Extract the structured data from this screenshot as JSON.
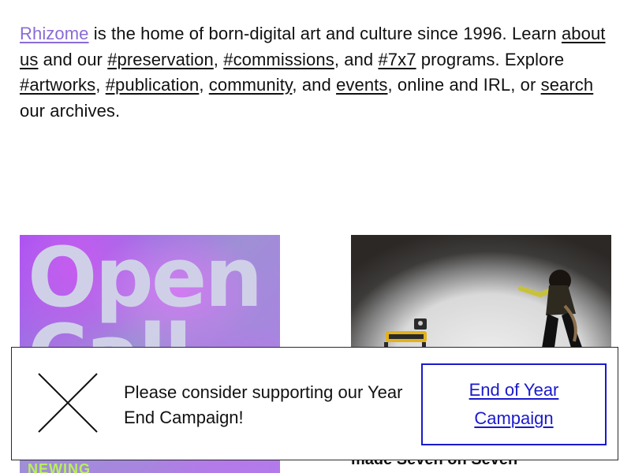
{
  "intro": {
    "brand": "Rhizome",
    "t1": " is the home of born-digital art and culture since 1996. Learn ",
    "about": "about us",
    "t2": " and our ",
    "preservation": "#preservation",
    "t3": ", ",
    "commissions": "#commissions",
    "t4": ", and ",
    "sevenbyseven": "#7x7",
    "t5": " programs. Explore ",
    "artworks": "#artworks",
    "t6": ", ",
    "publication": "#publication",
    "t7": ", ",
    "community": "community",
    "t8": ", and ",
    "events": "events",
    "t9": ", online and IRL, or ",
    "search": "search",
    "t10": " our archives."
  },
  "card_left": {
    "line1": "Open",
    "line2": "Call",
    "corner": "NEWING"
  },
  "card_right": {
    "caption": "made Seven on Seven"
  },
  "banner": {
    "message": "Please consider supporting our Year End Campaign!",
    "cta": "End of Year Campaign",
    "close_icon": "close-x-icon"
  },
  "colors": {
    "brand_link": "#8a6bd6",
    "cta_blue": "#1a1acc",
    "open_call_purple": "#a34ff3",
    "open_call_text": "#cfd0e8",
    "accent_green": "#b8f05a"
  }
}
